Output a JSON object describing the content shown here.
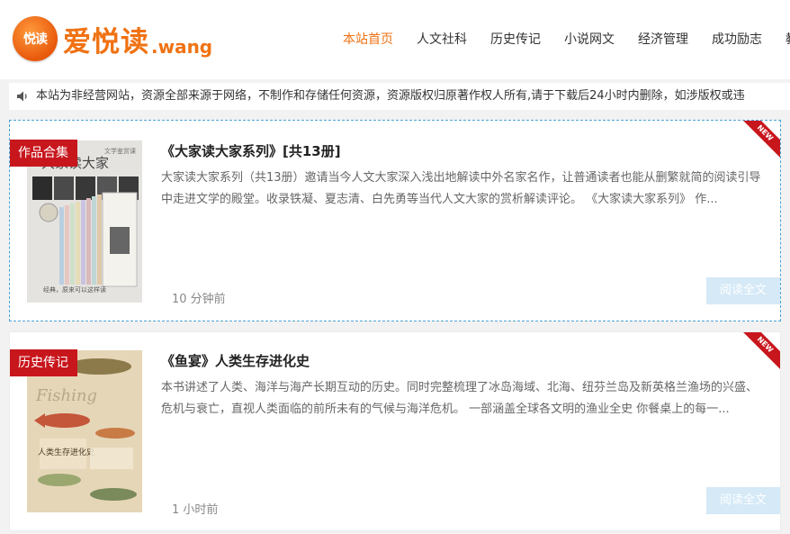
{
  "header": {
    "logo_badge": "悦读",
    "logo_name": "爱悦读",
    "logo_domain": ".wang",
    "nav": [
      {
        "label": "本站首页",
        "active": true
      },
      {
        "label": "人文社科",
        "active": false
      },
      {
        "label": "历史传记",
        "active": false
      },
      {
        "label": "小说网文",
        "active": false
      },
      {
        "label": "经济管理",
        "active": false
      },
      {
        "label": "成功励志",
        "active": false
      },
      {
        "label": "教",
        "active": false
      }
    ]
  },
  "notice": {
    "icon": "speaker-icon",
    "text": "本站为非经营网站，资源全部来源于网络，不制作和存储任何资源，资源版权归原著作权人所有,请于下载后24小时内删除，如涉版权或违"
  },
  "colors": {
    "accent": "#f07213",
    "tag_red": "#c8161d",
    "button_blue": "#d5e9f7",
    "active_border": "#4aa3d8"
  },
  "posts": [
    {
      "category": "作品合集",
      "badge": "NEW",
      "title": "《大家读大家系列》[共13册]",
      "description": "大家读大家系列（共13册）邀请当今人文大家深入浅出地解读中外名家名作，让普通读者也能从删繁就简的阅读引导中走进文学的殿堂。收录铁凝、夏志清、白先勇等当代人文大家的赏析解读评论。 《大家读大家系列》 作...",
      "time": "10 分钟前",
      "read_label": "阅读全文",
      "cover": {
        "top_text": "文学鉴赏课",
        "big_text": "大家读大家",
        "sub_text": "经典，原来可以这样读"
      }
    },
    {
      "category": "历史传记",
      "badge": "NEW",
      "title": "《鱼宴》人类生存进化史",
      "description": "本书讲述了人类、海洋与海产长期互动的历史。同时完整梳理了冰岛海域、北海、纽芬兰岛及新英格兰渔场的兴盛、危机与衰亡，直视人类面临的前所未有的气候与海洋危机。 一部涵盖全球各文明的渔业全史 你餐桌上的每一...",
      "time": "1 小时前",
      "read_label": "阅读全文",
      "cover": {
        "script_text": "Fishing",
        "subtitle": "人类生存进化史"
      }
    }
  ]
}
